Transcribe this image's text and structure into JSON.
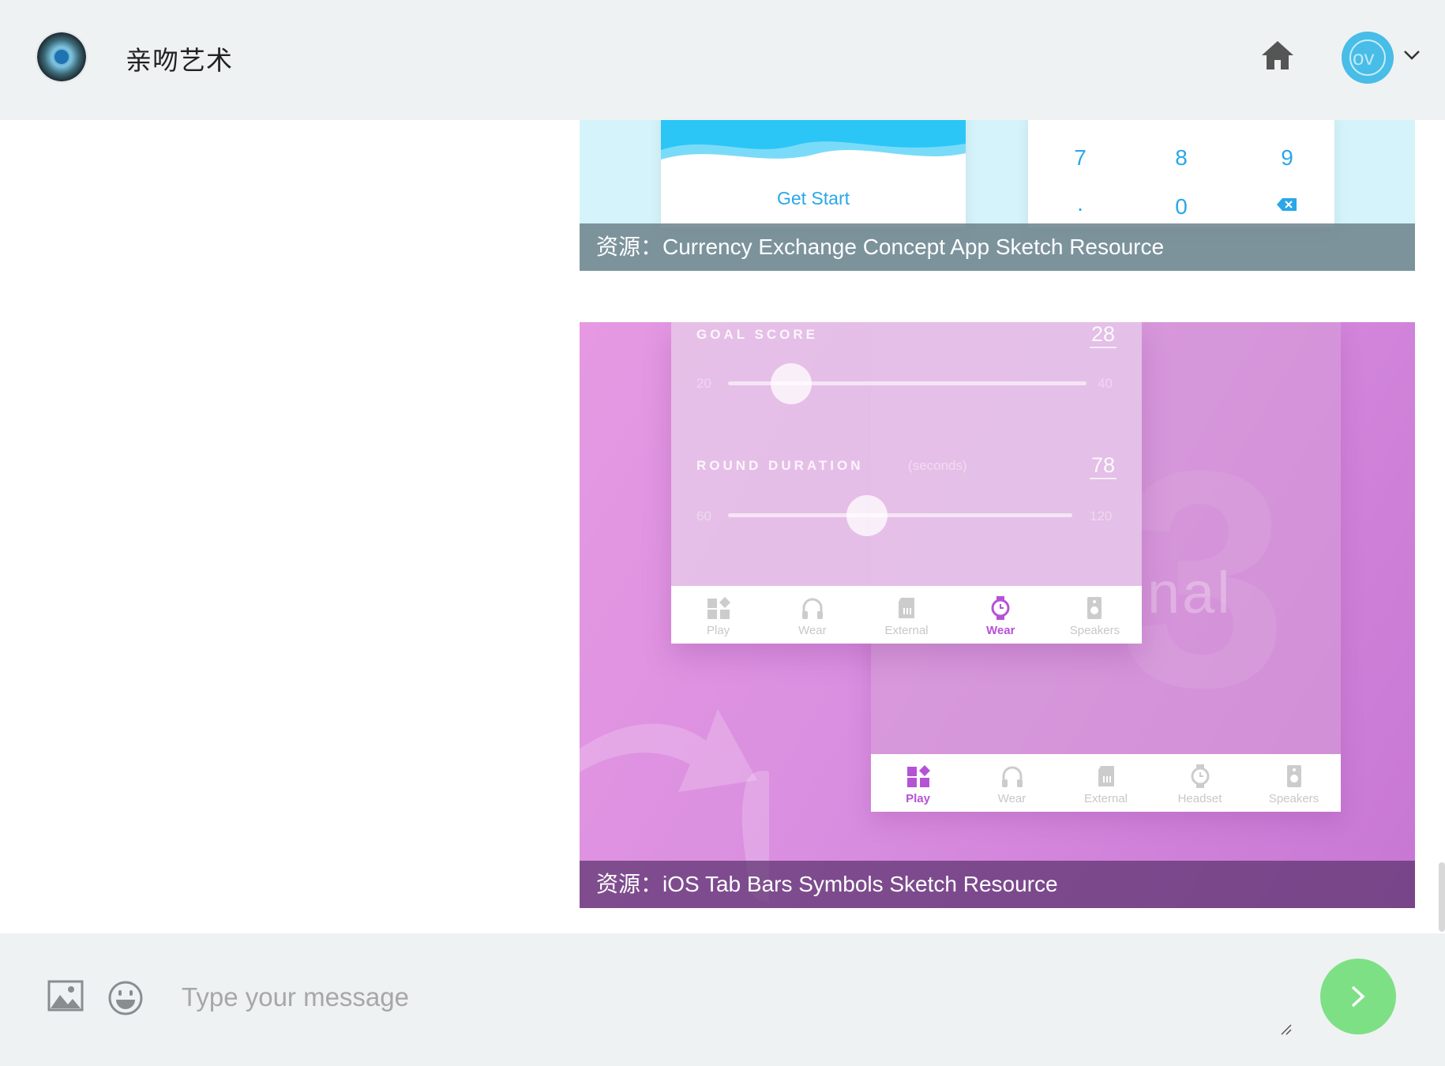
{
  "header": {
    "logo_icon": "app-logo-icon",
    "title": "亲吻艺术",
    "home_icon": "home-icon",
    "avatar_text": "ov",
    "avatar_color": "#47bde8",
    "chevron_icon": "chevron-down-icon"
  },
  "messages": [
    {
      "caption_prefix": "资源：",
      "caption_title": "Currency Exchange Concept App Sketch Resource",
      "image": {
        "button_label": "Get Start",
        "keys": [
          "7",
          "8",
          "9",
          ".",
          "0"
        ],
        "delete_icon": "backspace-icon"
      }
    },
    {
      "caption_prefix": "资源：",
      "caption_title": "iOS Tab Bars Symbols Sketch Resource",
      "image": {
        "goal_label": "GOAL SCORE",
        "goal_value": "28",
        "goal_min": "20",
        "goal_max": "40",
        "round_label": "ROUND DURATION",
        "round_sub": "(seconds)",
        "round_value": "78",
        "round_min": "60",
        "round_max": "120",
        "bg_text": "nal",
        "front_tabs": [
          "Play",
          "Wear",
          "External",
          "Wear",
          "Speakers"
        ],
        "back_tabs": [
          "Play",
          "Wear",
          "External",
          "Headset",
          "Speakers"
        ]
      }
    }
  ],
  "composer": {
    "image_icon": "image-icon",
    "emoji_icon": "emoji-icon",
    "placeholder": "Type your message",
    "send_icon": "chevron-right-icon",
    "send_color": "#7ee085"
  }
}
